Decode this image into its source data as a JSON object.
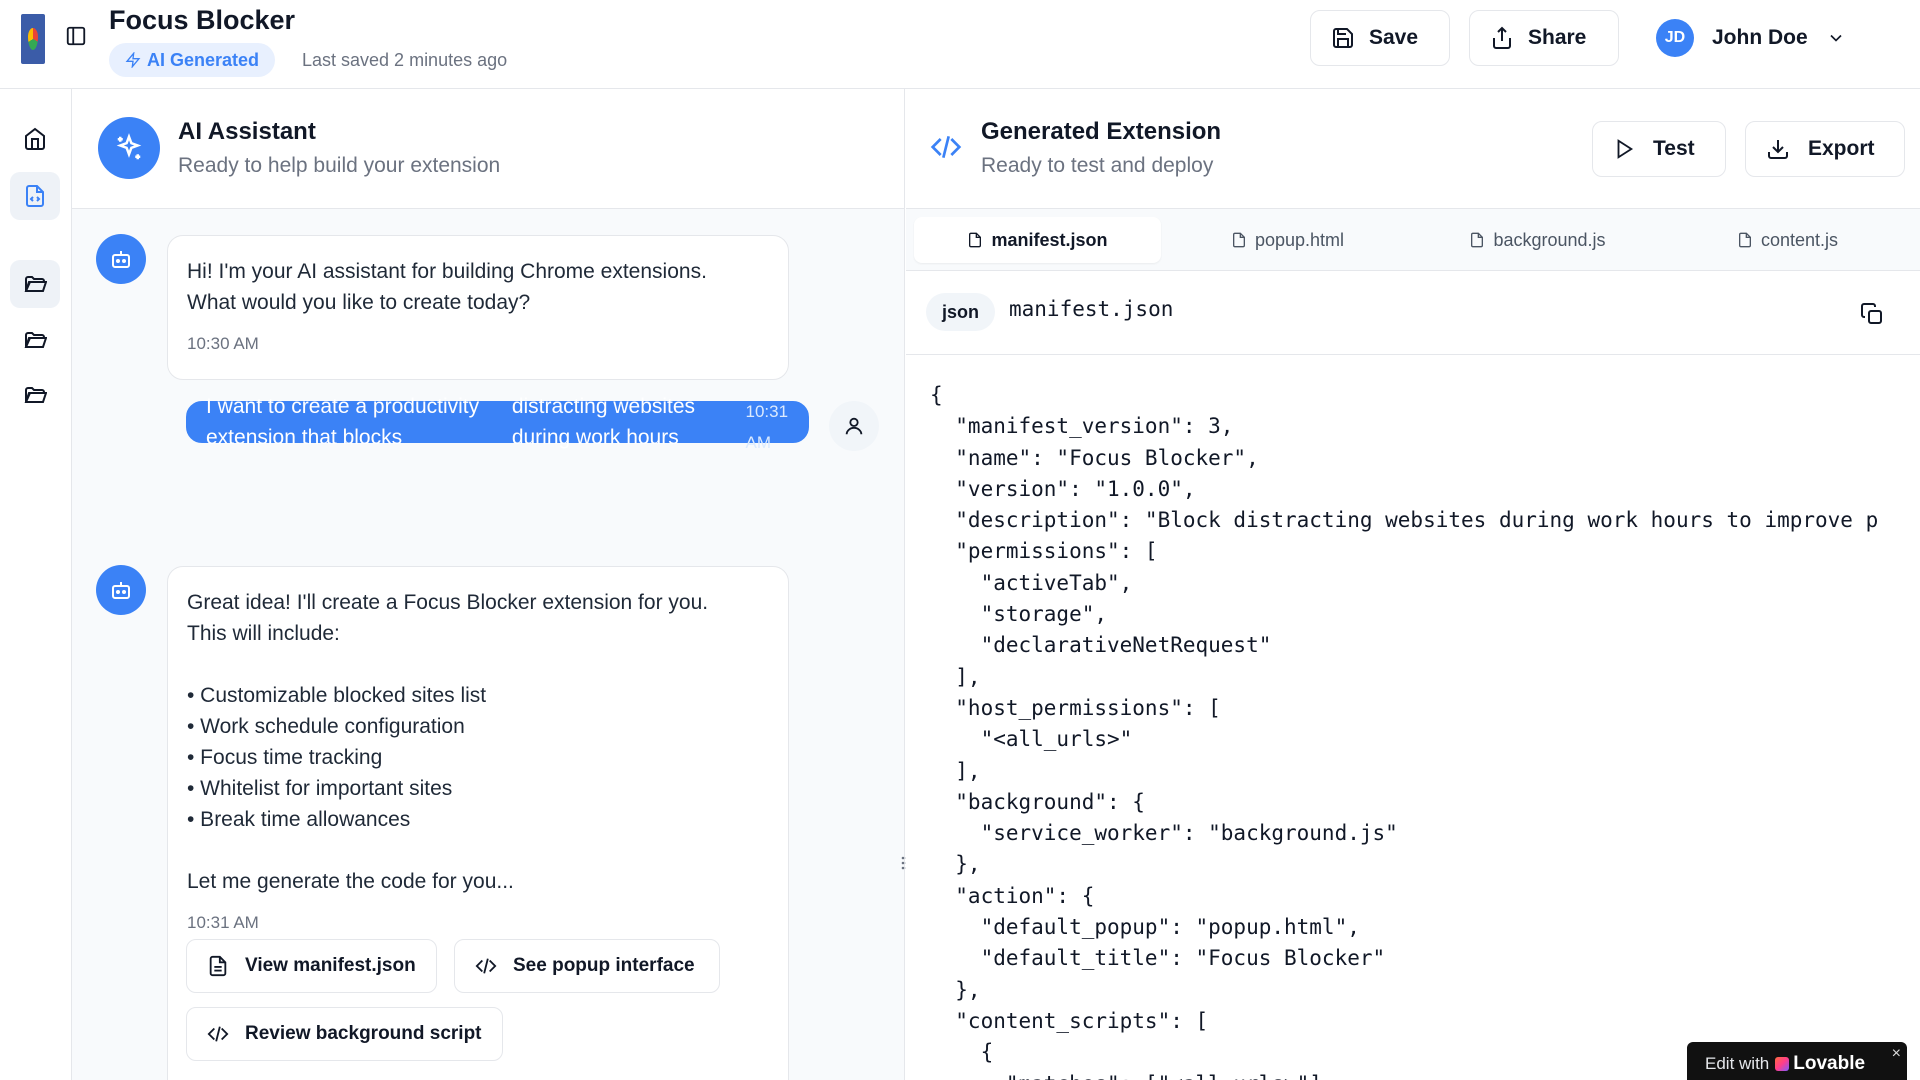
{
  "header": {
    "app_title": "Focus Blocker",
    "badge": "AI Generated",
    "last_saved": "Last saved 2 minutes ago",
    "save_label": "Save",
    "share_label": "Share",
    "user_initials": "JD",
    "user_name": "John Doe"
  },
  "chat": {
    "title": "AI Assistant",
    "subtitle": "Ready to help build your extension",
    "messages": [
      {
        "role": "assistant",
        "lines": [
          "Hi! I'm your AI assistant for building Chrome extensions.",
          "What would you like to create today?"
        ],
        "time": "10:30 AM"
      },
      {
        "role": "user",
        "lines": [
          "I want to create a productivity extension that blocks",
          "distracting websites during work hours"
        ],
        "time": "10:31 AM"
      },
      {
        "role": "assistant",
        "lines": [
          "Great idea! I'll create a Focus Blocker extension for you.",
          "This will include:",
          "",
          "• Customizable blocked sites list",
          "• Work schedule configuration",
          "• Focus time tracking",
          "• Whitelist for important sites",
          "• Break time allowances",
          "",
          "Let me generate the code for you..."
        ],
        "time": "10:31 AM"
      }
    ],
    "actions": [
      "View manifest.json",
      "See popup interface",
      "Review background script"
    ]
  },
  "code_panel": {
    "title": "Generated Extension",
    "subtitle": "Ready to test and deploy",
    "test_label": "Test",
    "export_label": "Export",
    "tabs": [
      "manifest.json",
      "popup.html",
      "background.js",
      "content.js"
    ],
    "active_tab": "manifest.json",
    "language": "json",
    "file_name": "manifest.json",
    "code_lines": [
      "{",
      "  \"manifest_version\": 3,",
      "  \"name\": \"Focus Blocker\",",
      "  \"version\": \"1.0.0\",",
      "  \"description\": \"Block distracting websites during work hours to improve p",
      "  \"permissions\": [",
      "    \"activeTab\",",
      "    \"storage\",",
      "    \"declarativeNetRequest\"",
      "  ],",
      "  \"host_permissions\": [",
      "    \"<all_urls>\"",
      "  ],",
      "  \"background\": {",
      "    \"service_worker\": \"background.js\"",
      "  },",
      "  \"action\": {",
      "    \"default_popup\": \"popup.html\",",
      "    \"default_title\": \"Focus Blocker\"",
      "  },",
      "  \"content_scripts\": [",
      "    {",
      "      \"matches\": [\"<all_urls>\"],"
    ]
  },
  "lovable": {
    "edit_with": "Edit with",
    "brand": "Lovable",
    "close": "×"
  },
  "colors": {
    "accent": "#3b82f6",
    "border": "#e5e7eb",
    "muted_text": "#6b7280"
  }
}
